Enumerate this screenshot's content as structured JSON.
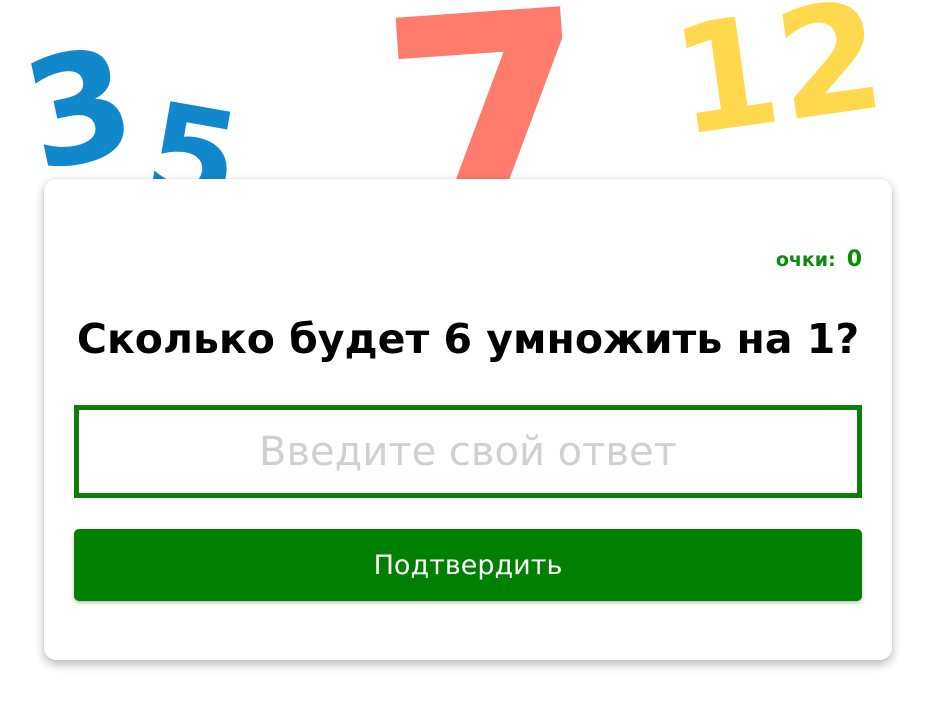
{
  "background": {
    "decorative_numbers": [
      {
        "text": "3",
        "color": "#1188cc"
      },
      {
        "text": "5",
        "color": "#1188cc"
      },
      {
        "text": "7",
        "color": "#ff7b6b"
      },
      {
        "text": "12",
        "color": "#ffd84d"
      }
    ]
  },
  "quiz": {
    "score_label": "очки:",
    "score_value": "0",
    "question": "Сколько будет 6 умножить на 1?",
    "answer_placeholder": "Введите свой ответ",
    "answer_value": "",
    "submit_label": "Подтвердить"
  },
  "colors": {
    "accent": "#008000",
    "score_text": "#0b8a0b",
    "input_border": "#0a800a"
  }
}
